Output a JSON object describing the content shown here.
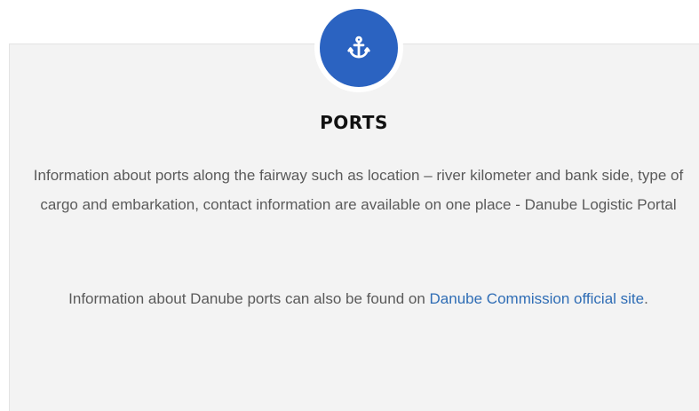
{
  "icon": "anchor-icon",
  "colors": {
    "accent": "#2b63c1",
    "link": "#2f6db5",
    "card_background": "#f3f3f3",
    "body_text": "#5a5a5a",
    "title_text": "#111111"
  },
  "section": {
    "title": "PORTS",
    "paragraph1": "Information about ports along the fairway such as location – river kilometer and bank side, type of cargo and embarkation, contact information are available on one place - Danube Logistic Portal",
    "paragraph2_prefix": "Information about Danube ports can also be found on ",
    "paragraph2_link": "Danube Commission official site",
    "paragraph2_suffix": "."
  }
}
